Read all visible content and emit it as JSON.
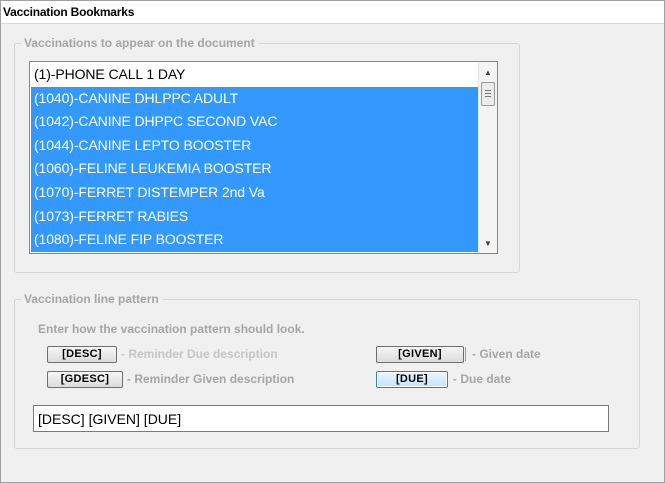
{
  "panel": {
    "title": "Vaccination Bookmarks"
  },
  "vaccinations_group": {
    "label": "Vaccinations to appear on the document",
    "items": [
      {
        "text": "(1)-PHONE CALL 1 DAY",
        "selected": false
      },
      {
        "text": "(1040)-CANINE DHLPPC ADULT",
        "selected": true
      },
      {
        "text": "(1042)-CANINE DHPPC SECOND VAC",
        "selected": true
      },
      {
        "text": "(1044)-CANINE LEPTO BOOSTER",
        "selected": true
      },
      {
        "text": "(1060)-FELINE LEUKEMIA BOOSTER",
        "selected": true
      },
      {
        "text": "(1070)-FERRET DISTEMPER 2nd Va",
        "selected": true
      },
      {
        "text": "(1073)-FERRET RABIES",
        "selected": true
      },
      {
        "text": "(1080)-FELINE FIP BOOSTER",
        "selected": true
      }
    ],
    "scroll_up_icon": "scroll-up-arrow-icon",
    "scroll_down_icon": "scroll-down-arrow-icon"
  },
  "pattern_group": {
    "label": "Vaccination line pattern",
    "hint": "Enter how the vaccination pattern should look.",
    "tokens": {
      "desc": {
        "label": "[DESC]",
        "description": "- Reminder Due description"
      },
      "gdesc": {
        "label": "[GDESC]",
        "description": "- Reminder Given description"
      },
      "given": {
        "label": "[GIVEN]",
        "description": "- Given date"
      },
      "due": {
        "label": "[DUE]",
        "description": "- Due date"
      }
    },
    "pattern_value": "[DESC] [GIVEN] [DUE]"
  },
  "colors": {
    "selection": "#3399ff",
    "disabled_text": "#a5a5a5",
    "focused_button": "#bee6fd"
  }
}
